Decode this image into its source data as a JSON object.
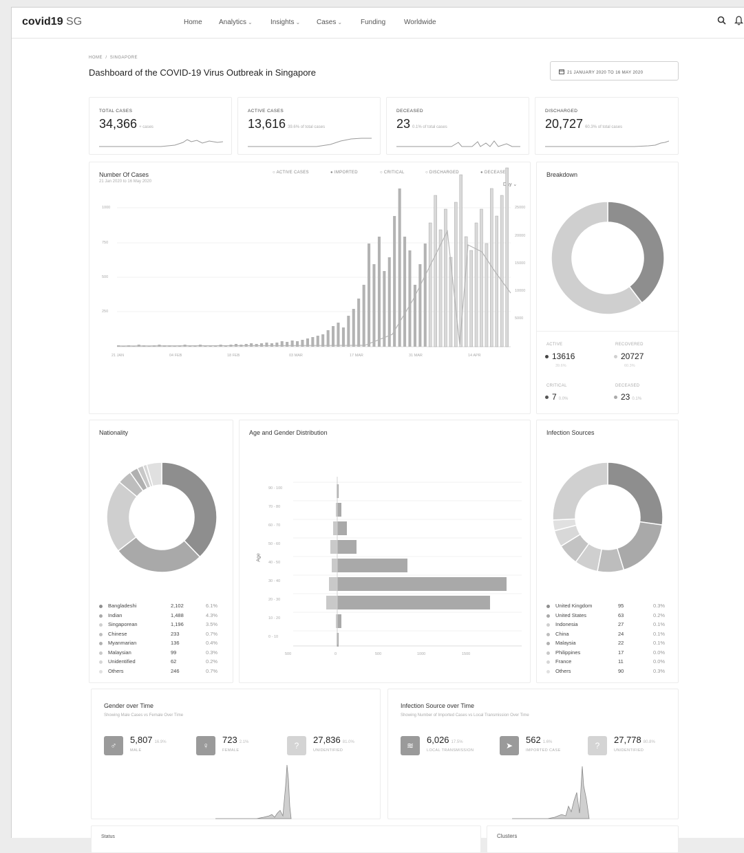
{
  "app": {
    "brand": "covid19",
    "brand_suffix": "SG"
  },
  "nav": [
    {
      "label": "Home",
      "dropdown": false
    },
    {
      "label": "Analytics",
      "dropdown": true
    },
    {
      "label": "Insights",
      "dropdown": true
    },
    {
      "label": "Cases",
      "dropdown": true
    },
    {
      "label": "Funding",
      "dropdown": false
    },
    {
      "label": "Worldwide",
      "dropdown": false
    }
  ],
  "icons": {
    "search": "search-icon",
    "notification": "bell-icon",
    "calendar": "calendar-icon",
    "male": "male-icon",
    "female": "female-icon",
    "unknown": "question-icon",
    "local": "wifi-icon",
    "imported": "plane-icon"
  },
  "breadcrumb": [
    "HOME",
    "SINGAPORE"
  ],
  "page_title": "Dashboard of the COVID-19 Virus Outbreak in Singapore",
  "date_range": "21 JANUARY 2020 TO 16 MAY 2020",
  "kpis": [
    {
      "label": "TOTAL CASES",
      "value": "34,366",
      "sub": "+ cases"
    },
    {
      "label": "ACTIVE CASES",
      "value": "13,616",
      "sub": "39.6% of total cases"
    },
    {
      "label": "DECEASED",
      "value": "23",
      "sub": "0.1% of total cases"
    },
    {
      "label": "DISCHARGED",
      "value": "20,727",
      "sub": "60.3% of total cases"
    }
  ],
  "cases_chart": {
    "title": "Number Of Cases",
    "subtitle": "21 Jan 2020 to 16 May 2020",
    "legend": [
      "ACTIVE CASES",
      "IMPORTED",
      "CRITICAL",
      "DISCHARGED",
      "DECEASED"
    ],
    "period_select": "Day",
    "y_left_ticks": [
      "1000",
      "750",
      "500",
      "250"
    ],
    "y_right_ticks": [
      "25000",
      "20000",
      "15000",
      "10000",
      "5000"
    ],
    "x_ticks": [
      "21 JAN",
      "04 FEB",
      "18 FEB",
      "03 MAR",
      "17 MAR",
      "31 MAR",
      "14 APR"
    ]
  },
  "breakdown": {
    "title": "Breakdown",
    "items": [
      {
        "label": "ACTIVE",
        "value": "13616",
        "sub": "39.6%"
      },
      {
        "label": "RECOVERED",
        "value": "20727",
        "sub": "60.3%"
      },
      {
        "label": "CRITICAL",
        "value": "7",
        "sub": "0.0%"
      },
      {
        "label": "DECEASED",
        "value": "23",
        "sub": "0.1%"
      }
    ]
  },
  "nationality": {
    "title": "Nationality",
    "rows": [
      {
        "name": "Bangladeshi",
        "count": "2,102",
        "pct": "6.1%"
      },
      {
        "name": "Indian",
        "count": "1,488",
        "pct": "4.3%"
      },
      {
        "name": "Singaporean",
        "count": "1,196",
        "pct": "3.5%"
      },
      {
        "name": "Chinese",
        "count": "233",
        "pct": "0.7%"
      },
      {
        "name": "Myanmarian",
        "count": "136",
        "pct": "0.4%"
      },
      {
        "name": "Malaysian",
        "count": "99",
        "pct": "0.3%"
      },
      {
        "name": "Unidentified",
        "count": "62",
        "pct": "0.2%"
      },
      {
        "name": "Others",
        "count": "246",
        "pct": "0.7%"
      }
    ]
  },
  "age_gender": {
    "title": "Age and Gender Distribution",
    "y_axis_label": "Age",
    "age_bands": [
      "90 - 100",
      "70 - 80",
      "60 - 70",
      "50 - 60",
      "40 - 50",
      "30 - 40",
      "20 - 30",
      "10 - 20",
      "0 - 10"
    ],
    "x_ticks": [
      "500",
      "0",
      "500",
      "1000",
      "1500"
    ]
  },
  "infection_sources": {
    "title": "Infection Sources",
    "rows": [
      {
        "name": "United Kingdom",
        "count": "95",
        "pct": "0.3%"
      },
      {
        "name": "United States",
        "count": "63",
        "pct": "0.2%"
      },
      {
        "name": "Indonesia",
        "count": "27",
        "pct": "0.1%"
      },
      {
        "name": "China",
        "count": "24",
        "pct": "0.1%"
      },
      {
        "name": "Malaysia",
        "count": "22",
        "pct": "0.1%"
      },
      {
        "name": "Philippines",
        "count": "17",
        "pct": "0.0%"
      },
      {
        "name": "France",
        "count": "11",
        "pct": "0.0%"
      },
      {
        "name": "Others",
        "count": "90",
        "pct": "0.3%"
      }
    ]
  },
  "gender_time": {
    "title": "Gender over Time",
    "subtitle": "Showing Male Cases vs Female Over Time",
    "stats": [
      {
        "value": "5,807",
        "pct": "16.9%",
        "label": "MALE"
      },
      {
        "value": "723",
        "pct": "2.1%",
        "label": "FEMALE"
      },
      {
        "value": "27,836",
        "pct": "81.0%",
        "label": "UNIDENTIFIED"
      }
    ]
  },
  "source_time": {
    "title": "Infection Source over Time",
    "subtitle": "Showing Number of Imported Cases vs Local Transmission Over Time",
    "stats": [
      {
        "value": "6,026",
        "pct": "17.5%",
        "label": "LOCAL TRANSMISSION"
      },
      {
        "value": "562",
        "pct": "1.6%",
        "label": "IMPORTED CASE"
      },
      {
        "value": "27,778",
        "pct": "80.8%",
        "label": "UNIDENTIFIED"
      }
    ]
  },
  "bottom_cards": [
    {
      "title": "Status"
    },
    {
      "title": "Clusters"
    }
  ],
  "colors": {
    "dark": "#8a8a8a",
    "mid": "#a8a8a8",
    "light": "#cfcfcf",
    "lighter": "#e2e2e2",
    "axis": "#dcdcdc"
  }
}
